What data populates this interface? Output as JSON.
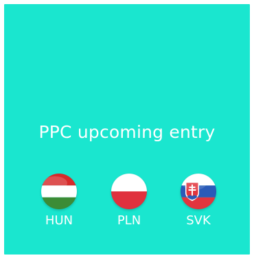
{
  "title": "PPC upcoming entry",
  "flags": [
    {
      "code": "HUN",
      "icon": "hungary-flag-icon"
    },
    {
      "code": "PLN",
      "icon": "poland-flag-icon"
    },
    {
      "code": "SVK",
      "icon": "slovakia-flag-icon"
    }
  ],
  "colors": {
    "background": "#1ae6cf",
    "text": "#ffffff"
  }
}
